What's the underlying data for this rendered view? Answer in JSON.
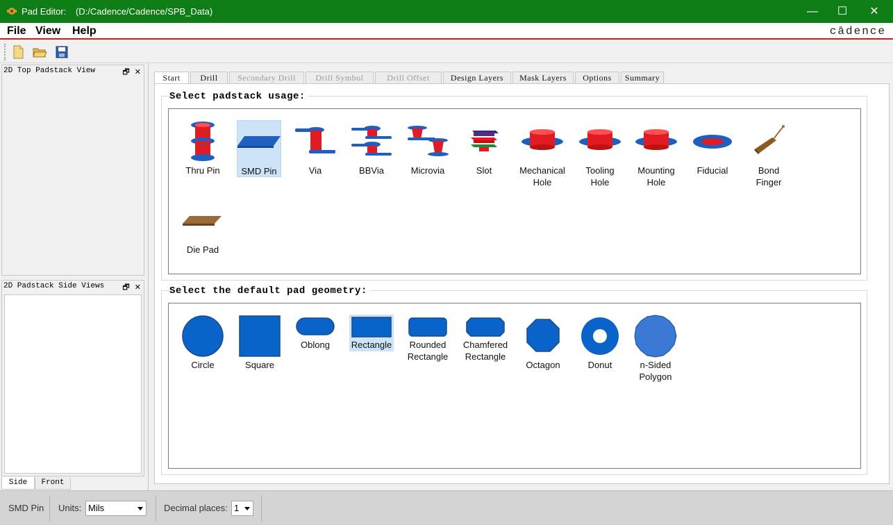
{
  "window": {
    "title": "Pad Editor:",
    "path": "(D:/Cadence/Cadence/SPB_Data)",
    "minimize": "—",
    "maximize": "☐",
    "close": "✕"
  },
  "menu": {
    "file": "File",
    "view": "View",
    "help": "Help",
    "brand": "cādence"
  },
  "toolbar": {
    "buttons": [
      "new-file-icon",
      "open-folder-icon",
      "save-icon"
    ]
  },
  "docks": {
    "top_view": {
      "title": "2D Top Padstack View",
      "float": "🗗",
      "close": "✕"
    },
    "side_view": {
      "title": "2D Padstack Side Views",
      "float": "🗗",
      "close": "✕"
    },
    "bottom_tabs": [
      "Side",
      "Front"
    ]
  },
  "tabs": [
    {
      "label": "Start",
      "state": "active"
    },
    {
      "label": "Drill",
      "state": "normal"
    },
    {
      "label": "Secondary Drill",
      "state": "disabled"
    },
    {
      "label": "Drill Symbol",
      "state": "disabled"
    },
    {
      "label": "Drill Offset",
      "state": "disabled"
    },
    {
      "label": "Design Layers",
      "state": "normal"
    },
    {
      "label": "Mask Layers",
      "state": "normal"
    },
    {
      "label": "Options",
      "state": "normal"
    },
    {
      "label": "Summary",
      "state": "normal"
    }
  ],
  "usage": {
    "title": "Select padstack usage:",
    "selected": "SMD Pin",
    "items": [
      {
        "label1": "Thru Pin",
        "label2": ""
      },
      {
        "label1": "SMD Pin",
        "label2": ""
      },
      {
        "label1": "Via",
        "label2": ""
      },
      {
        "label1": "BBVia",
        "label2": ""
      },
      {
        "label1": "Microvia",
        "label2": ""
      },
      {
        "label1": "Slot",
        "label2": ""
      },
      {
        "label1": "Mechanical",
        "label2": "Hole"
      },
      {
        "label1": "Tooling",
        "label2": "Hole"
      },
      {
        "label1": "Mounting",
        "label2": "Hole"
      },
      {
        "label1": "Fiducial",
        "label2": ""
      },
      {
        "label1": "Bond",
        "label2": "Finger"
      },
      {
        "label1": "Die Pad",
        "label2": ""
      }
    ]
  },
  "geometry": {
    "title": "Select the default pad geometry:",
    "selected": "Rectangle",
    "items": [
      {
        "label1": "Circle",
        "label2": ""
      },
      {
        "label1": "Square",
        "label2": ""
      },
      {
        "label1": "Oblong",
        "label2": ""
      },
      {
        "label1": "Rectangle",
        "label2": ""
      },
      {
        "label1": "Rounded",
        "label2": "Rectangle"
      },
      {
        "label1": "Chamfered",
        "label2": "Rectangle"
      },
      {
        "label1": "Octagon",
        "label2": ""
      },
      {
        "label1": "Donut",
        "label2": ""
      },
      {
        "label1": "n-Sided",
        "label2": "Polygon"
      }
    ]
  },
  "status": {
    "usage": "SMD Pin",
    "units_label": "Units:",
    "units_value": "Mils",
    "decimal_label": "Decimal places:",
    "decimal_value": "1"
  },
  "colors": {
    "titlebar": "#0f7d16",
    "accent_red": "#cc1f1f",
    "pad_blue": "#0a63c9",
    "barrel_red": "#e01b24",
    "selection": "#cde3f7"
  }
}
